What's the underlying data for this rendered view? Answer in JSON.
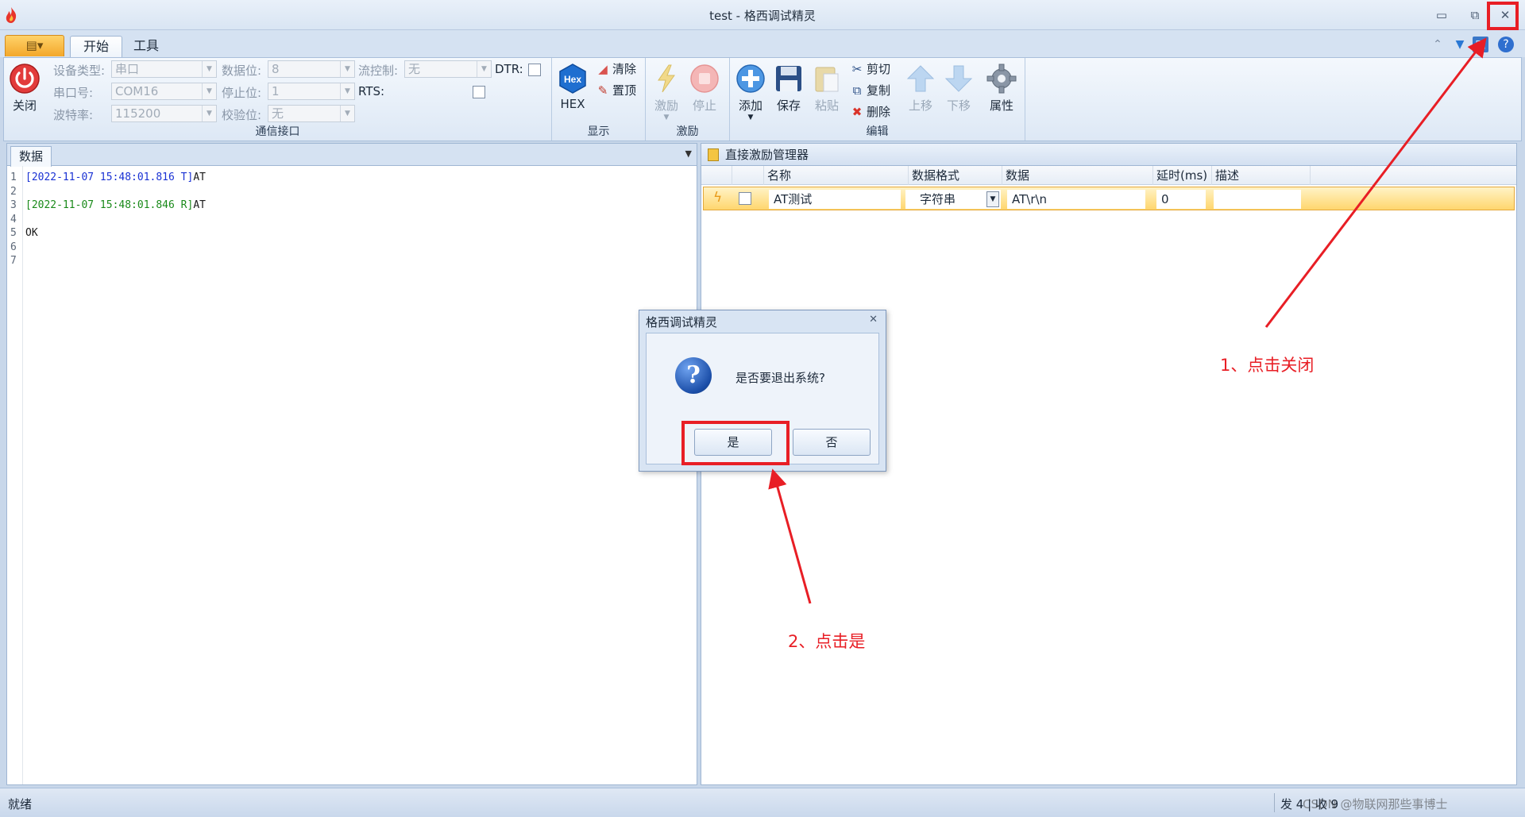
{
  "window": {
    "title": "test - 格西调试精灵",
    "min_glyph": "▭",
    "restore_glyph": "⧉",
    "close_glyph": "✕"
  },
  "ribbon_tabs": {
    "start": "开始",
    "tools": "工具"
  },
  "comm_group": {
    "close_label": "关闭",
    "device_type_label": "设备类型:",
    "device_type_value": "串口",
    "port_label": "串口号:",
    "port_value": "COM16",
    "baud_label": "波特率:",
    "baud_value": "115200",
    "databits_label": "数据位:",
    "databits_value": "8",
    "stopbits_label": "停止位:",
    "stopbits_value": "1",
    "parity_label": "校验位:",
    "parity_value": "无",
    "flow_label": "流控制:",
    "flow_value": "无",
    "dtr_label": "DTR:",
    "rts_label": "RTS:",
    "group_label": "通信接口"
  },
  "display_group": {
    "hex_label": "HEX",
    "hex_icon_text": "Hex",
    "clear_label": "清除",
    "pin_label": "置顶",
    "group_label": "显示"
  },
  "stimulus_group": {
    "stimulus_label": "激励",
    "stop_label": "停止",
    "group_label": "激励"
  },
  "edit_group": {
    "add_label": "添加",
    "save_label": "保存",
    "paste_label": "粘贴",
    "cut_label": "剪切",
    "copy_label": "复制",
    "delete_label": "删除",
    "up_label": "上移",
    "down_label": "下移",
    "properties_label": "属性",
    "group_label": "编辑"
  },
  "data_panel": {
    "tab_label": "数据",
    "lines": [
      {
        "n": "1",
        "text": "[2022-11-07 15:48:01.816 T]",
        "tail": "AT",
        "kind": "send"
      },
      {
        "n": "2",
        "text": "",
        "tail": "",
        "kind": "plain"
      },
      {
        "n": "3",
        "text": "[2022-11-07 15:48:01.846 R]",
        "tail": "AT",
        "kind": "recv"
      },
      {
        "n": "4",
        "text": "",
        "tail": "",
        "kind": "plain"
      },
      {
        "n": "5",
        "text": "",
        "tail": "OK",
        "kind": "plain"
      },
      {
        "n": "6",
        "text": "",
        "tail": "",
        "kind": "plain"
      },
      {
        "n": "7",
        "text": "",
        "tail": "",
        "kind": "plain"
      }
    ]
  },
  "manager_panel": {
    "title": "直接激励管理器",
    "columns": {
      "name": "名称",
      "format": "数据格式",
      "data": "数据",
      "delay": "延时(ms)",
      "desc": "描述"
    },
    "row": {
      "name": "AT测试",
      "format": "字符串",
      "data": "AT\\r\\n",
      "delay": "0",
      "desc": ""
    }
  },
  "dialog": {
    "title": "格西调试精灵",
    "message": "是否要退出系统?",
    "yes_label": "是",
    "no_label": "否",
    "icon_glyph": "?"
  },
  "status_bar": {
    "left": "就绪",
    "right": "发 4 | 收 9",
    "watermark": "CSDN @物联网那些事博士"
  },
  "annotations": {
    "step1": "1、点击关闭",
    "step2": "2、点击是",
    "color": "#e81e25"
  }
}
